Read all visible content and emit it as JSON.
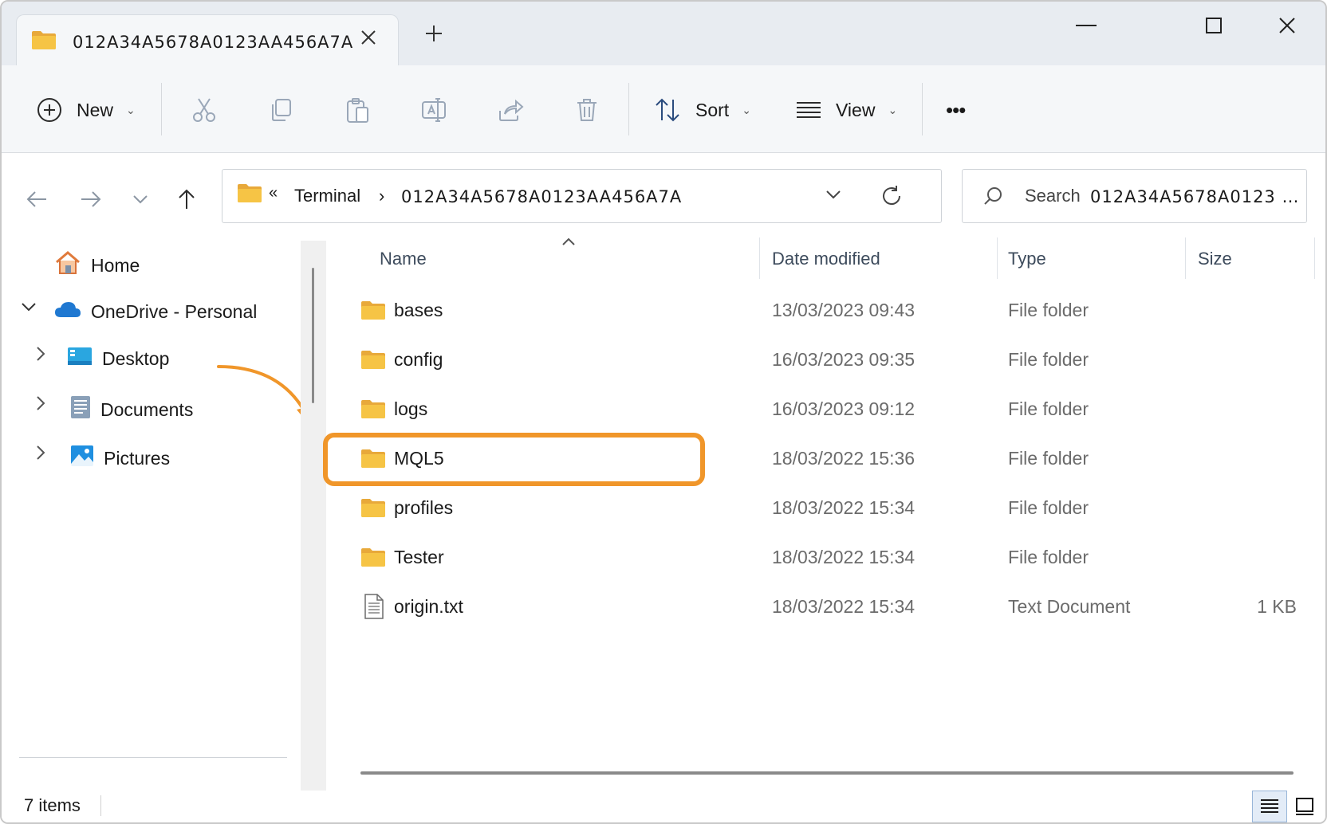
{
  "window": {
    "tab_title": "012A34A5678A0123AA456A7A",
    "colors": {
      "accent": "#0067c0",
      "highlight": "#f0962a",
      "folder": "#f6c445"
    }
  },
  "toolbar": {
    "new_label": "New",
    "sort_label": "Sort",
    "view_label": "View",
    "more_label": "•••"
  },
  "address": {
    "overflow": "«",
    "crumb_1": "Terminal",
    "separator": "›",
    "crumb_2": "012A34A5678A0123AA456A7A"
  },
  "search": {
    "label": "Search",
    "scope": "012A34A5678A0123 …"
  },
  "sidebar": {
    "items": [
      {
        "label": "Home",
        "icon": "home-icon"
      },
      {
        "label": "OneDrive - Personal",
        "icon": "cloud-icon"
      },
      {
        "label": "Desktop",
        "icon": "desktop-icon"
      },
      {
        "label": "Documents",
        "icon": "documents-icon"
      },
      {
        "label": "Pictures",
        "icon": "pictures-icon"
      }
    ]
  },
  "columns": {
    "name": "Name",
    "date": "Date modified",
    "type": "Type",
    "size": "Size"
  },
  "files": [
    {
      "name": "bases",
      "date": "13/03/2023 09:43",
      "type": "File folder",
      "size": ""
    },
    {
      "name": "config",
      "date": "16/03/2023 09:35",
      "type": "File folder",
      "size": ""
    },
    {
      "name": "logs",
      "date": "16/03/2023 09:12",
      "type": "File folder",
      "size": ""
    },
    {
      "name": "MQL5",
      "date": "18/03/2022 15:36",
      "type": "File folder",
      "size": ""
    },
    {
      "name": "profiles",
      "date": "18/03/2022 15:34",
      "type": "File folder",
      "size": ""
    },
    {
      "name": "Tester",
      "date": "18/03/2022 15:34",
      "type": "File folder",
      "size": ""
    },
    {
      "name": "origin.txt",
      "date": "18/03/2022 15:34",
      "type": "Text Document",
      "size": "1 KB"
    }
  ],
  "status": {
    "items_count": "7 items"
  }
}
